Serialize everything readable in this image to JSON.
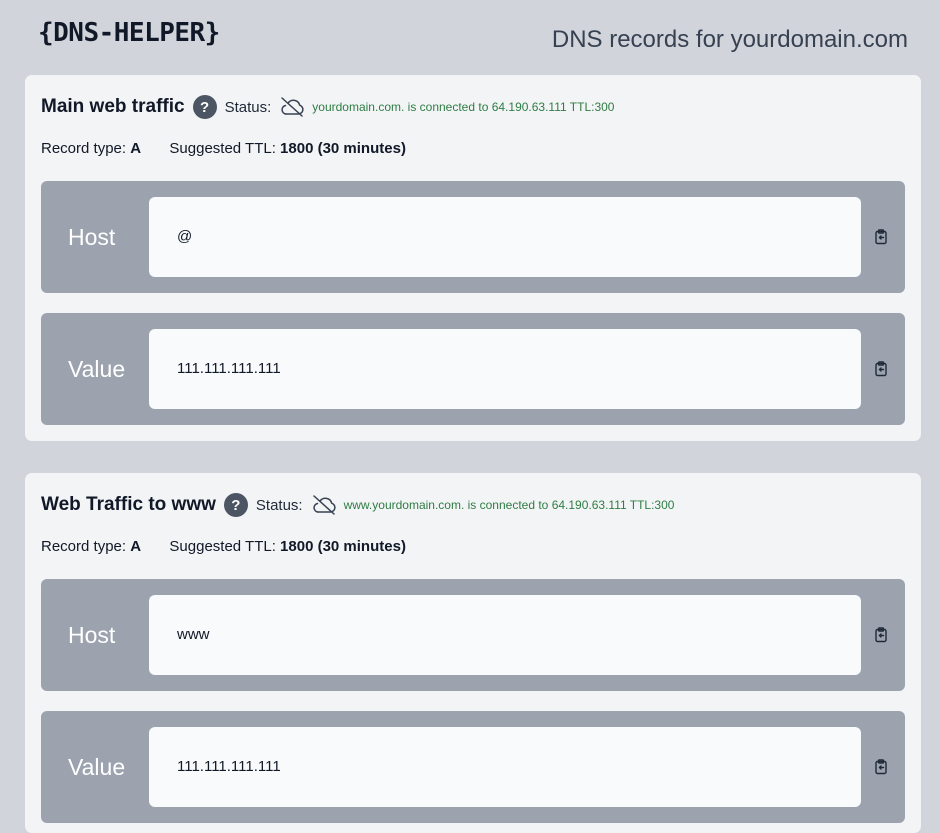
{
  "header": {
    "logo": "{DNS-HELPER}",
    "page_heading": "DNS records for yourdomain.com"
  },
  "labels": {
    "status": "Status:",
    "record_type": "Record type:",
    "suggested_ttl": "Suggested TTL:",
    "help": "?"
  },
  "records": [
    {
      "title": "Main web traffic",
      "status_text": "yourdomain.com. is connected to 64.190.63.111 TTL:300",
      "record_type": "A",
      "ttl": "1800 (30 minutes)",
      "fields": [
        {
          "label": "Host",
          "value": "@"
        },
        {
          "label": "Value",
          "value": "111.111.111.111"
        }
      ]
    },
    {
      "title": "Web Traffic to www",
      "status_text": "www.yourdomain.com. is connected to 64.190.63.111 TTL:300",
      "record_type": "A",
      "ttl": "1800 (30 minutes)",
      "fields": [
        {
          "label": "Host",
          "value": "www"
        },
        {
          "label": "Value",
          "value": "111.111.111.111"
        }
      ]
    }
  ],
  "icons": {
    "status": "cloud-off-icon",
    "copy": "clipboard-copy-icon",
    "help": "question-icon"
  },
  "colors": {
    "background": "#d1d5db",
    "card": "#f3f4f6",
    "field_row": "#9ca3af",
    "status_ok": "#2f7d44",
    "help_badge": "#4b5563"
  }
}
